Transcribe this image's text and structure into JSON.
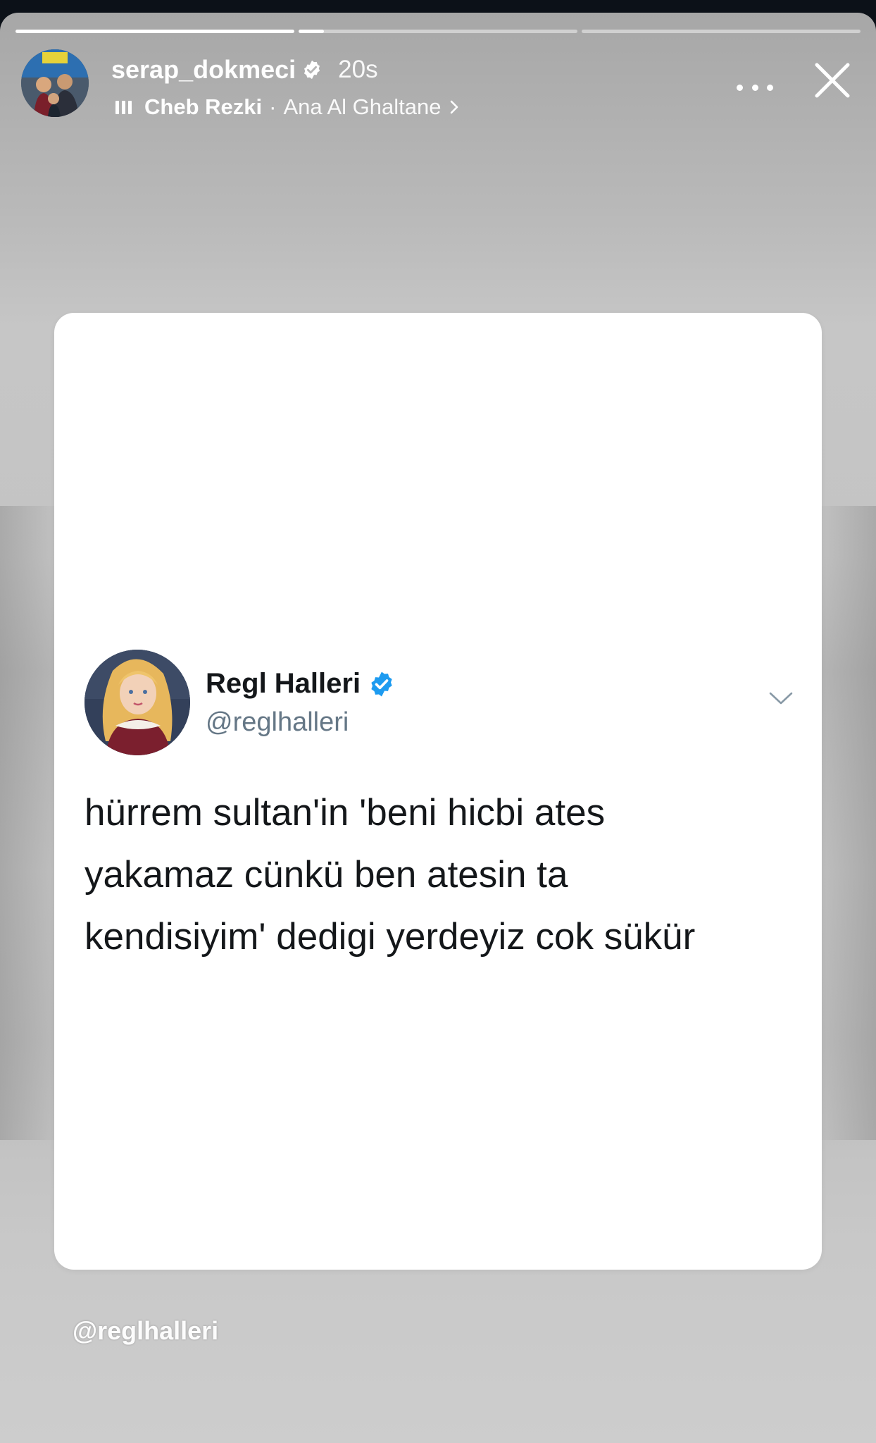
{
  "progress": {
    "segments": [
      1.0,
      0.09,
      0.0
    ]
  },
  "header": {
    "username": "serap_dokmeci",
    "time_ago": "20s",
    "music": {
      "artist": "Cheb Rezki",
      "separator": "·",
      "song": "Ana Al Ghaltane"
    },
    "icons": {
      "more": "more-horizontal-icon",
      "close": "close-icon",
      "verified": "verified-badge-icon",
      "music": "music-bars-icon"
    }
  },
  "tweet": {
    "name": "Regl Halleri",
    "handle": "@reglhalleri",
    "text_lines": [
      "hürrem sultan'in 'beni hicbi ates",
      "yakamaz cünkü ben atesin ta",
      "kendisiyim' dedigi yerdeyiz cok sükür"
    ],
    "verified_color": "#1d9bf0"
  },
  "mention": "@reglhalleri"
}
